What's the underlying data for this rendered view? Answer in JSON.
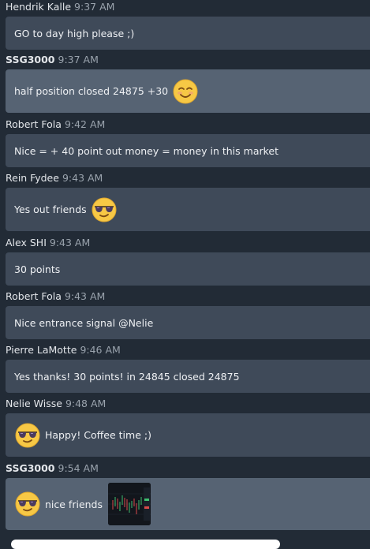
{
  "messages": [
    {
      "author": "Hendrik Kalle",
      "time": "9:37 AM",
      "text": "GO to day high please ;)"
    },
    {
      "author": "SSG3000",
      "time": "9:37 AM",
      "text": "half position closed 24875 +30",
      "emoji": "smiling-face-icon"
    },
    {
      "author": "Robert Fola",
      "time": "9:42 AM",
      "text": "Nice = + 40 point out money = money in this market"
    },
    {
      "author": "Rein Fydee",
      "time": "9:43 AM",
      "text": "Yes out friends",
      "emoji": "sunglasses-face-icon"
    },
    {
      "author": "Alex SHI",
      "time": "9:43 AM",
      "text": "30 points"
    },
    {
      "author": "Robert Fola",
      "time": "9:43 AM",
      "text": "Nice entrance signal @Nelie"
    },
    {
      "author": "Pierre LaMotte",
      "time": "9:46 AM",
      "text": "Yes thanks! 30 points! in 24845 closed 24875"
    },
    {
      "author": "Nelie Wisse",
      "time": "9:48 AM",
      "text": "Happy! Coffee time ;)",
      "emoji": "sunglasses-face-icon"
    },
    {
      "author": "SSG3000",
      "time": "9:54 AM",
      "text": "nice friends",
      "emoji": "sunglasses-face-icon",
      "attachment": "chart-thumbnail"
    }
  ],
  "colors": {
    "background": "#222b36",
    "bubble": "#3f4a59",
    "bubble_highlight": "#566373",
    "timestamp": "#9aa3ad"
  }
}
